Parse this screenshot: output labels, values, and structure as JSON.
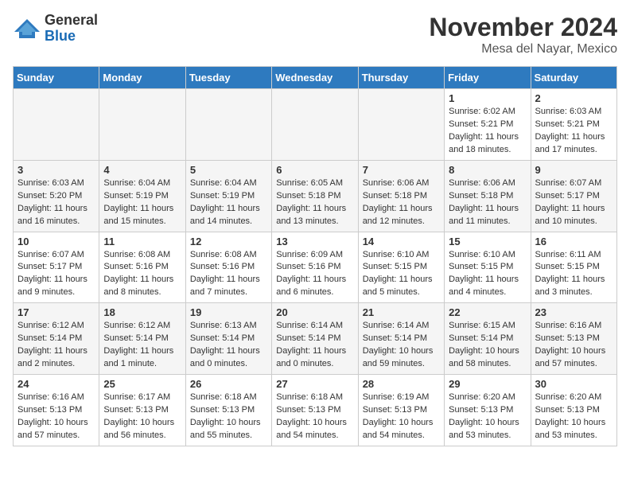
{
  "header": {
    "logo_line1": "General",
    "logo_line2": "Blue",
    "month_title": "November 2024",
    "location": "Mesa del Nayar, Mexico"
  },
  "weekdays": [
    "Sunday",
    "Monday",
    "Tuesday",
    "Wednesday",
    "Thursday",
    "Friday",
    "Saturday"
  ],
  "weeks": [
    [
      {
        "day": "",
        "info": ""
      },
      {
        "day": "",
        "info": ""
      },
      {
        "day": "",
        "info": ""
      },
      {
        "day": "",
        "info": ""
      },
      {
        "day": "",
        "info": ""
      },
      {
        "day": "1",
        "info": "Sunrise: 6:02 AM\nSunset: 5:21 PM\nDaylight: 11 hours\nand 18 minutes."
      },
      {
        "day": "2",
        "info": "Sunrise: 6:03 AM\nSunset: 5:21 PM\nDaylight: 11 hours\nand 17 minutes."
      }
    ],
    [
      {
        "day": "3",
        "info": "Sunrise: 6:03 AM\nSunset: 5:20 PM\nDaylight: 11 hours\nand 16 minutes."
      },
      {
        "day": "4",
        "info": "Sunrise: 6:04 AM\nSunset: 5:19 PM\nDaylight: 11 hours\nand 15 minutes."
      },
      {
        "day": "5",
        "info": "Sunrise: 6:04 AM\nSunset: 5:19 PM\nDaylight: 11 hours\nand 14 minutes."
      },
      {
        "day": "6",
        "info": "Sunrise: 6:05 AM\nSunset: 5:18 PM\nDaylight: 11 hours\nand 13 minutes."
      },
      {
        "day": "7",
        "info": "Sunrise: 6:06 AM\nSunset: 5:18 PM\nDaylight: 11 hours\nand 12 minutes."
      },
      {
        "day": "8",
        "info": "Sunrise: 6:06 AM\nSunset: 5:18 PM\nDaylight: 11 hours\nand 11 minutes."
      },
      {
        "day": "9",
        "info": "Sunrise: 6:07 AM\nSunset: 5:17 PM\nDaylight: 11 hours\nand 10 minutes."
      }
    ],
    [
      {
        "day": "10",
        "info": "Sunrise: 6:07 AM\nSunset: 5:17 PM\nDaylight: 11 hours\nand 9 minutes."
      },
      {
        "day": "11",
        "info": "Sunrise: 6:08 AM\nSunset: 5:16 PM\nDaylight: 11 hours\nand 8 minutes."
      },
      {
        "day": "12",
        "info": "Sunrise: 6:08 AM\nSunset: 5:16 PM\nDaylight: 11 hours\nand 7 minutes."
      },
      {
        "day": "13",
        "info": "Sunrise: 6:09 AM\nSunset: 5:16 PM\nDaylight: 11 hours\nand 6 minutes."
      },
      {
        "day": "14",
        "info": "Sunrise: 6:10 AM\nSunset: 5:15 PM\nDaylight: 11 hours\nand 5 minutes."
      },
      {
        "day": "15",
        "info": "Sunrise: 6:10 AM\nSunset: 5:15 PM\nDaylight: 11 hours\nand 4 minutes."
      },
      {
        "day": "16",
        "info": "Sunrise: 6:11 AM\nSunset: 5:15 PM\nDaylight: 11 hours\nand 3 minutes."
      }
    ],
    [
      {
        "day": "17",
        "info": "Sunrise: 6:12 AM\nSunset: 5:14 PM\nDaylight: 11 hours\nand 2 minutes."
      },
      {
        "day": "18",
        "info": "Sunrise: 6:12 AM\nSunset: 5:14 PM\nDaylight: 11 hours\nand 1 minute."
      },
      {
        "day": "19",
        "info": "Sunrise: 6:13 AM\nSunset: 5:14 PM\nDaylight: 11 hours\nand 0 minutes."
      },
      {
        "day": "20",
        "info": "Sunrise: 6:14 AM\nSunset: 5:14 PM\nDaylight: 11 hours\nand 0 minutes."
      },
      {
        "day": "21",
        "info": "Sunrise: 6:14 AM\nSunset: 5:14 PM\nDaylight: 10 hours\nand 59 minutes."
      },
      {
        "day": "22",
        "info": "Sunrise: 6:15 AM\nSunset: 5:14 PM\nDaylight: 10 hours\nand 58 minutes."
      },
      {
        "day": "23",
        "info": "Sunrise: 6:16 AM\nSunset: 5:13 PM\nDaylight: 10 hours\nand 57 minutes."
      }
    ],
    [
      {
        "day": "24",
        "info": "Sunrise: 6:16 AM\nSunset: 5:13 PM\nDaylight: 10 hours\nand 57 minutes."
      },
      {
        "day": "25",
        "info": "Sunrise: 6:17 AM\nSunset: 5:13 PM\nDaylight: 10 hours\nand 56 minutes."
      },
      {
        "day": "26",
        "info": "Sunrise: 6:18 AM\nSunset: 5:13 PM\nDaylight: 10 hours\nand 55 minutes."
      },
      {
        "day": "27",
        "info": "Sunrise: 6:18 AM\nSunset: 5:13 PM\nDaylight: 10 hours\nand 54 minutes."
      },
      {
        "day": "28",
        "info": "Sunrise: 6:19 AM\nSunset: 5:13 PM\nDaylight: 10 hours\nand 54 minutes."
      },
      {
        "day": "29",
        "info": "Sunrise: 6:20 AM\nSunset: 5:13 PM\nDaylight: 10 hours\nand 53 minutes."
      },
      {
        "day": "30",
        "info": "Sunrise: 6:20 AM\nSunset: 5:13 PM\nDaylight: 10 hours\nand 53 minutes."
      }
    ]
  ]
}
